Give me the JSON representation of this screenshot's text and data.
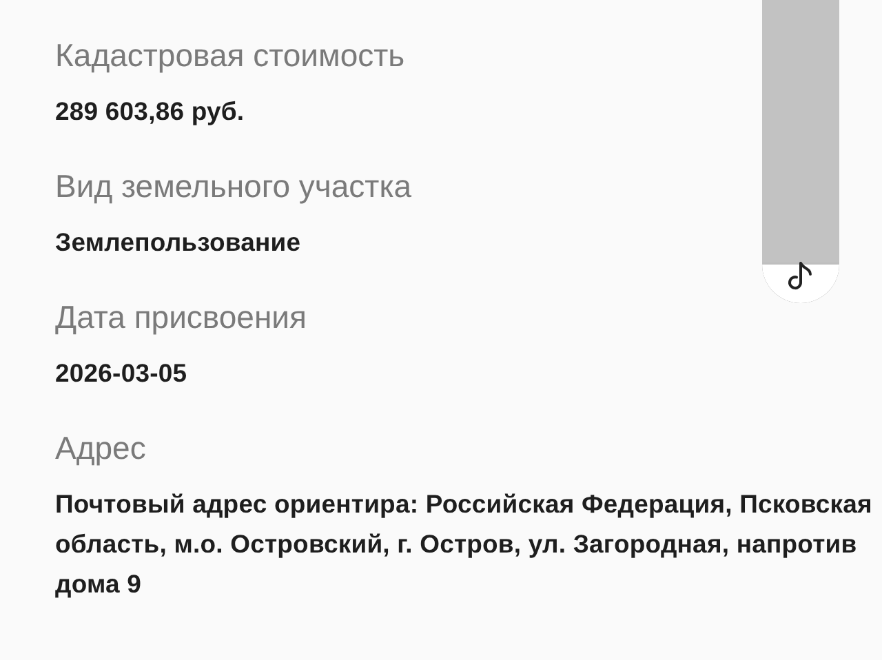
{
  "fields": [
    {
      "label": "Кадастровая стоимость",
      "value": "289 603,86 руб."
    },
    {
      "label": "Вид земельного участка",
      "value": "Землепользование"
    },
    {
      "label": "Дата присвоения",
      "value": "2026-03-05"
    },
    {
      "label": "Адрес",
      "value": "Почтовый адрес ориентира: Российская Федерация, Псковская область, м.о. Островский, г. Остров, ул. Загородная, напротив дома 9"
    }
  ]
}
